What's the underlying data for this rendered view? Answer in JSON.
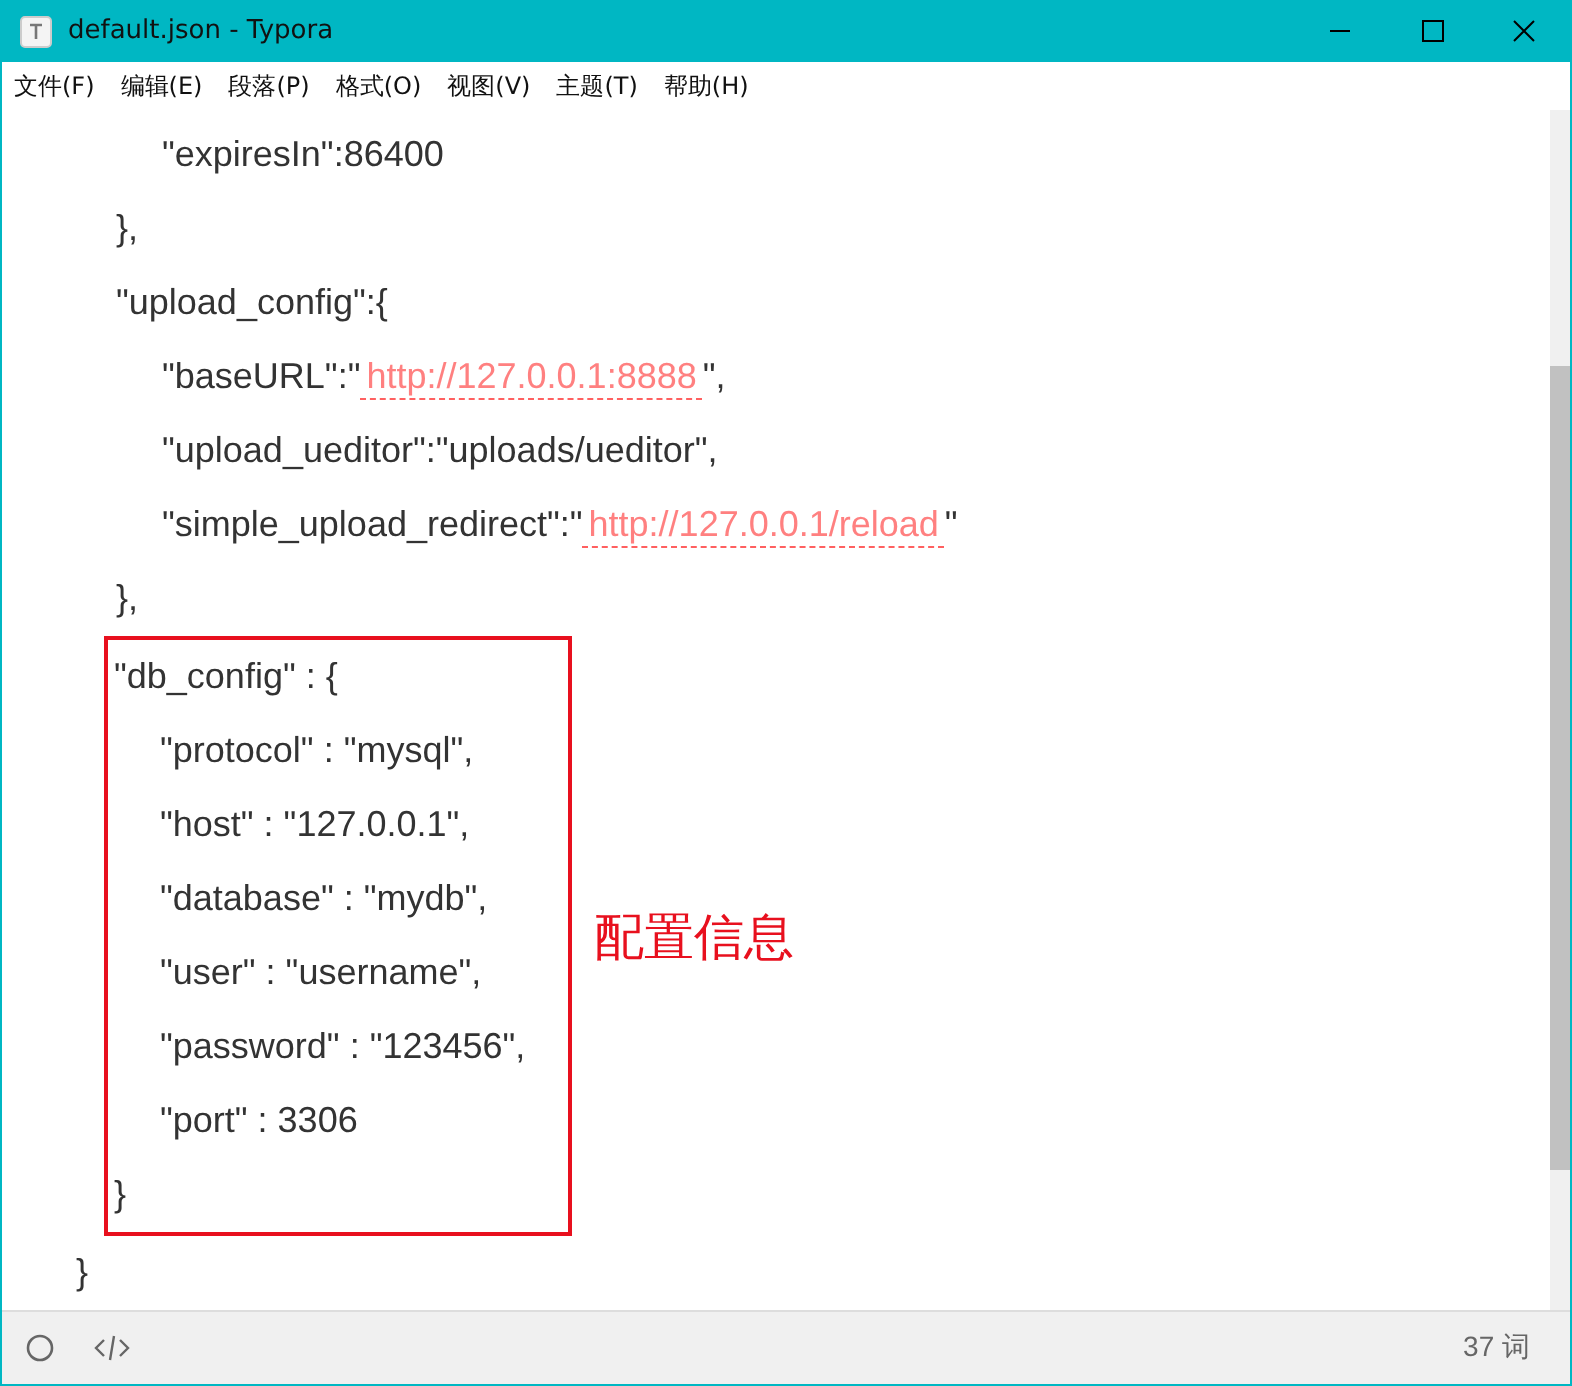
{
  "window": {
    "title": "default.json - Typora"
  },
  "menu": [
    "文件(F)",
    "编辑(E)",
    "段落(P)",
    "格式(O)",
    "视图(V)",
    "主题(T)",
    "帮助(H)"
  ],
  "code": [
    {
      "children": [
        {
          "children": [
            {
              "segments": [
                {
                  "text": "\"expiresIn\":86400"
                }
              ]
            }
          ],
          "close": "},"
        },
        {
          "segments": [
            {
              "text": "\"upload_config\":{"
            }
          ],
          "children": [
            {
              "segments": [
                {
                  "text": "\"baseURL\":\""
                },
                {
                  "kind": "link",
                  "text": "http://127.0.0.1:8888"
                },
                {
                  "text": "\","
                }
              ]
            },
            {
              "segments": [
                {
                  "text": "\"upload_ueditor\":\"uploads/ueditor\","
                }
              ]
            },
            {
              "segments": [
                {
                  "text": "\"simple_upload_redirect\":\""
                },
                {
                  "kind": "link",
                  "text": "http://127.0.0.1/reload"
                },
                {
                  "text": "\""
                }
              ]
            }
          ],
          "close": "},"
        },
        {
          "segments": [
            {
              "text": "\"db_config\" : {"
            }
          ],
          "highlighted": true,
          "note": "配置信息",
          "children": [
            {
              "segments": [
                {
                  "text": "\"protocol\" : \"mysql\","
                }
              ]
            },
            {
              "segments": [
                {
                  "text": "\"host\" : \"127.0.0.1\","
                }
              ]
            },
            {
              "segments": [
                {
                  "text": "\"database\" : \"mydb\","
                }
              ]
            },
            {
              "segments": [
                {
                  "text": "\"user\" : \"username\","
                }
              ]
            },
            {
              "segments": [
                {
                  "text": "\"password\" : \"123456\","
                }
              ]
            },
            {
              "segments": [
                {
                  "text": "\"port\" : 3306"
                }
              ]
            }
          ],
          "close": "}"
        }
      ],
      "close": "}"
    }
  ],
  "status_bar": {
    "word_count": "37 词"
  }
}
